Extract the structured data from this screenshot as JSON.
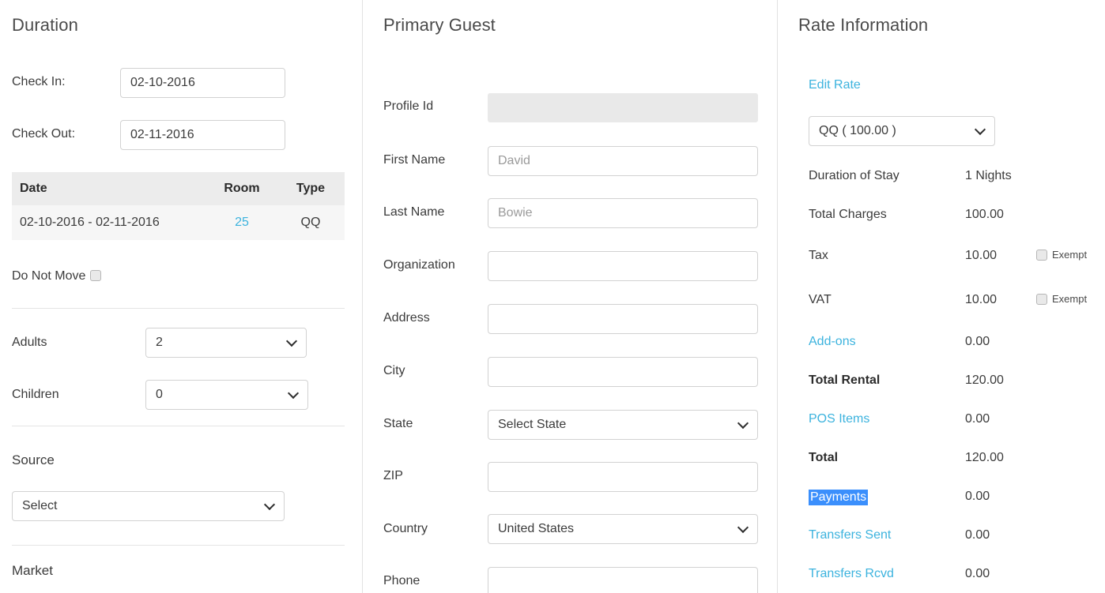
{
  "colors": {
    "link": "#3cb3de",
    "selection_bg": "#3b8ffc",
    "selection_fg": "#ffffff",
    "table_header_bg": "#ececec",
    "table_row_bg": "#f6f6f6",
    "disabled_bg": "#e9e9e9"
  },
  "duration": {
    "title": "Duration",
    "check_in_label": "Check In:",
    "check_in_value": "02-10-2016",
    "check_out_label": "Check Out:",
    "check_out_value": "02-11-2016",
    "table": {
      "headers": [
        "Date",
        "Room",
        "Type"
      ],
      "rows": [
        {
          "date": "02-10-2016 - 02-11-2016",
          "room": "25",
          "type": "QQ"
        }
      ]
    },
    "do_not_move_label": "Do Not Move",
    "do_not_move_checked": false,
    "adults_label": "Adults",
    "adults_value": "2",
    "children_label": "Children",
    "children_value": "0",
    "source_label": "Source",
    "source_value": "Select",
    "market_label": "Market"
  },
  "guest": {
    "title": "Primary Guest",
    "fields": [
      {
        "label": "Profile Id",
        "type": "disabled",
        "value": "",
        "placeholder": ""
      },
      {
        "label": "First Name",
        "type": "text",
        "value": "",
        "placeholder": "David"
      },
      {
        "label": "Last Name",
        "type": "text",
        "value": "",
        "placeholder": "Bowie"
      },
      {
        "label": "Organization",
        "type": "text",
        "value": "",
        "placeholder": ""
      },
      {
        "label": "Address",
        "type": "text",
        "value": "",
        "placeholder": ""
      },
      {
        "label": "City",
        "type": "text",
        "value": "",
        "placeholder": ""
      },
      {
        "label": "State",
        "type": "select",
        "value": "Select State",
        "placeholder": ""
      },
      {
        "label": "ZIP",
        "type": "text",
        "value": "",
        "placeholder": ""
      },
      {
        "label": "Country",
        "type": "select",
        "value": "United States",
        "placeholder": ""
      },
      {
        "label": "Phone",
        "type": "text",
        "value": "",
        "placeholder": ""
      }
    ]
  },
  "rate": {
    "title": "Rate Information",
    "edit_rate_label": "Edit Rate",
    "rate_select_value": "QQ ( 100.00 )",
    "exempt_label": "Exempt",
    "rows": [
      {
        "name": "Duration of Stay",
        "value": "1 Nights",
        "style": "plain",
        "exempt": false
      },
      {
        "name": "Total Charges",
        "value": "100.00",
        "style": "plain",
        "exempt": false
      },
      {
        "name": "Tax",
        "value": "10.00",
        "style": "plain",
        "exempt": true,
        "exempt_checked": false
      },
      {
        "name": "VAT",
        "value": "10.00",
        "style": "plain",
        "exempt": true,
        "exempt_checked": false
      },
      {
        "name": "Add-ons",
        "value": "0.00",
        "style": "link",
        "exempt": false
      },
      {
        "name": "Total Rental",
        "value": "120.00",
        "style": "bold",
        "exempt": false
      },
      {
        "name": "POS Items",
        "value": "0.00",
        "style": "link",
        "exempt": false
      },
      {
        "name": "Total",
        "value": "120.00",
        "style": "bold",
        "exempt": false
      },
      {
        "name": "Payments",
        "value": "0.00",
        "style": "selected",
        "exempt": false
      },
      {
        "name": "Transfers Sent",
        "value": "0.00",
        "style": "link",
        "exempt": false
      },
      {
        "name": "Transfers Rcvd",
        "value": "0.00",
        "style": "link",
        "exempt": false
      }
    ]
  }
}
